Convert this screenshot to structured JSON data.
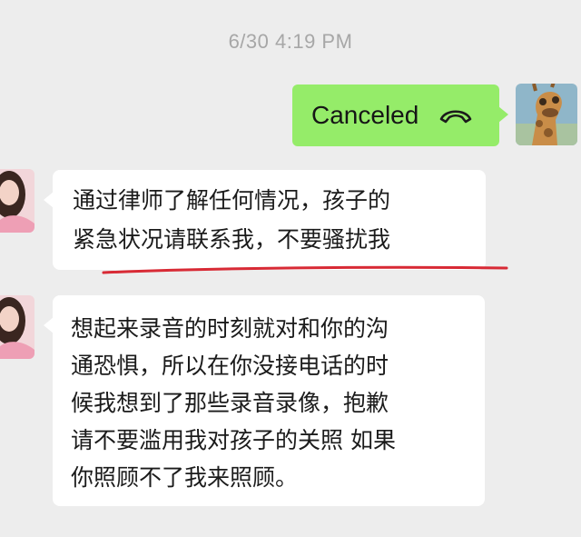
{
  "chat": {
    "timestamp": "6/30 4:19 PM",
    "call": {
      "label": "Canceled",
      "icon": "hangup-phone-icon"
    },
    "messages": [
      {
        "lines": [
          "通过律师了解任何情况，孩子的",
          "紧急状况请联系我，不要骚扰我"
        ]
      },
      {
        "lines": [
          "想起来录音的时刻就对和你的沟",
          "通恐惧，所以在你没接电话的时",
          "候我想到了那些录音录像，抱歉",
          "请不要滥用我对孩子的关照 如果",
          "你照顾不了我来照顾。"
        ]
      }
    ]
  },
  "colors": {
    "background": "#ededed",
    "outgoing_bubble": "#95ec69",
    "incoming_bubble": "#ffffff",
    "underline_annotation": "#d82a35"
  }
}
